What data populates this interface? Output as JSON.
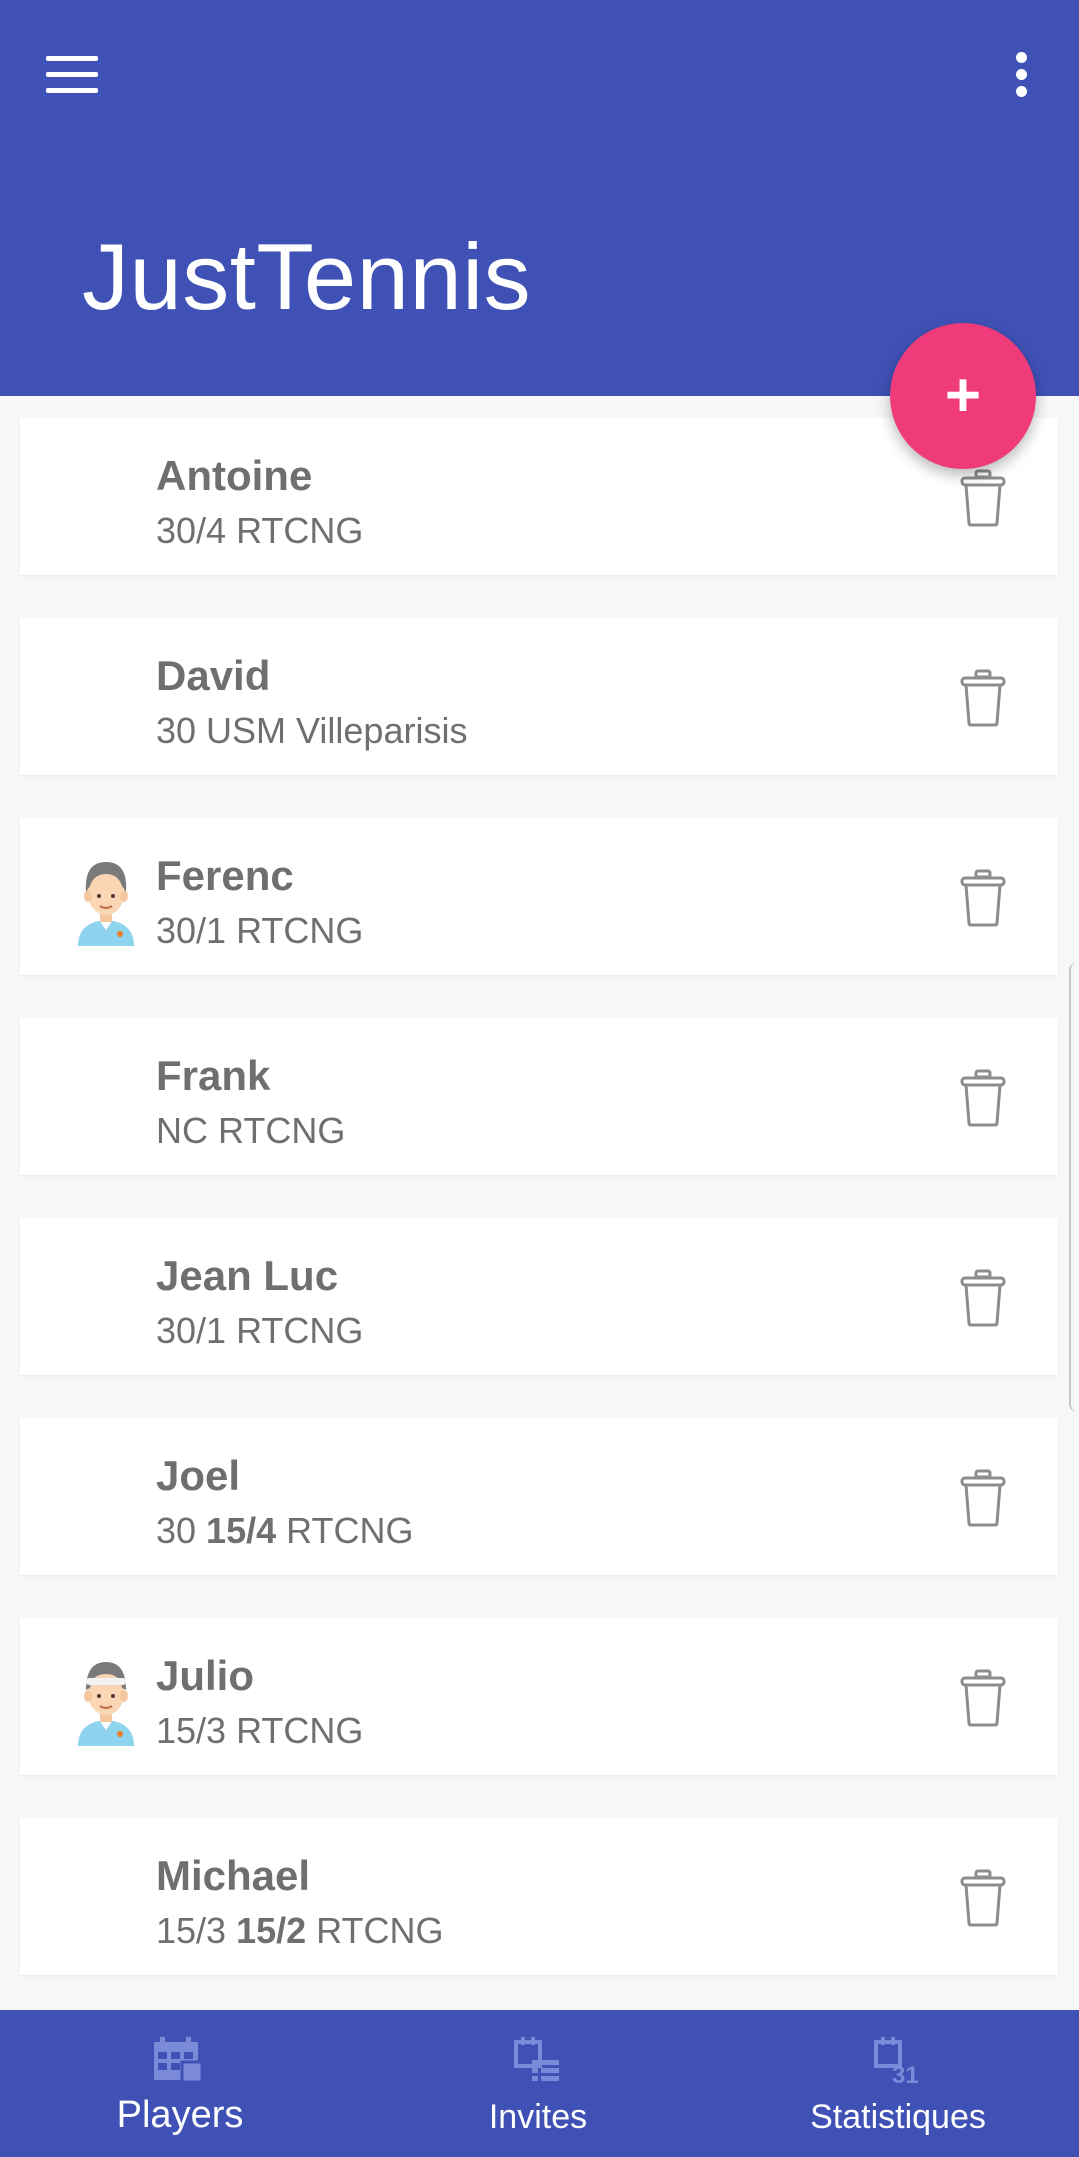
{
  "app": {
    "title": "JustTennis",
    "accent_color": "#3f51b5",
    "fab_color": "#f03b7a",
    "fab_label": "+"
  },
  "players": [
    {
      "name": "Antoine",
      "info_parts": [
        {
          "text": "30/4 RTCNG",
          "bold": false
        }
      ],
      "avatar": null
    },
    {
      "name": "David",
      "info_parts": [
        {
          "text": "30 USM Villeparisis",
          "bold": false
        }
      ],
      "avatar": null
    },
    {
      "name": "Ferenc",
      "info_parts": [
        {
          "text": "30/1 RTCNG",
          "bold": false
        }
      ],
      "avatar": "man-avatar-icon"
    },
    {
      "name": "Frank",
      "info_parts": [
        {
          "text": "NC RTCNG",
          "bold": false
        }
      ],
      "avatar": null
    },
    {
      "name": "Jean Luc",
      "info_parts": [
        {
          "text": "30/1 RTCNG",
          "bold": false
        }
      ],
      "avatar": null
    },
    {
      "name": "Joel",
      "info_parts": [
        {
          "text": "30 ",
          "bold": false
        },
        {
          "text": "15/4",
          "bold": true
        },
        {
          "text": " RTCNG",
          "bold": false
        }
      ],
      "avatar": null
    },
    {
      "name": "Julio",
      "info_parts": [
        {
          "text": "15/3 RTCNG",
          "bold": false
        }
      ],
      "avatar": "man-headband-avatar-icon"
    },
    {
      "name": "Michael",
      "info_parts": [
        {
          "text": "15/3 ",
          "bold": false
        },
        {
          "text": "15/2",
          "bold": true
        },
        {
          "text": " RTCNG",
          "bold": false
        }
      ],
      "avatar": null
    }
  ],
  "bottom_nav": [
    {
      "label": "Players",
      "icon": "calendar-grid-icon",
      "active": true
    },
    {
      "label": "Invites",
      "icon": "calendar-list-icon",
      "active": false
    },
    {
      "label": "Statistiques",
      "icon": "calendar-31-icon",
      "active": false
    }
  ]
}
